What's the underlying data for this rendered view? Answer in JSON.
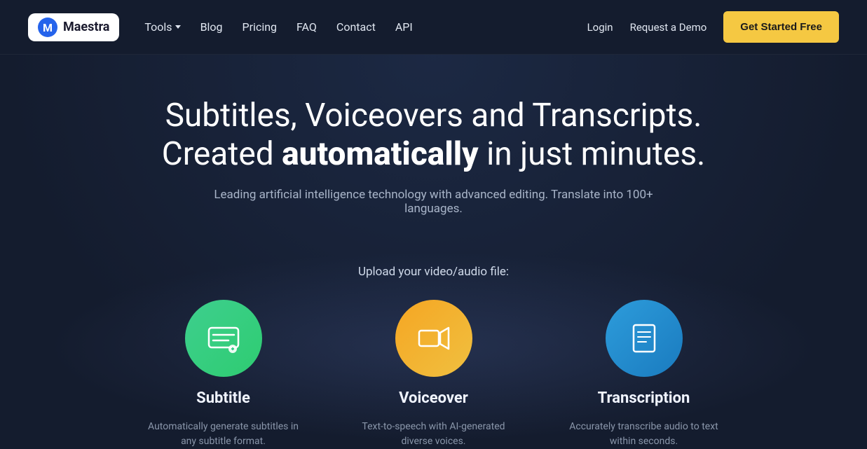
{
  "logo": {
    "text": "Maestra",
    "aria": "Maestra logo"
  },
  "nav": {
    "tools_label": "Tools",
    "blog_label": "Blog",
    "pricing_label": "Pricing",
    "faq_label": "FAQ",
    "contact_label": "Contact",
    "api_label": "API",
    "login_label": "Login",
    "request_demo_label": "Request a Demo",
    "get_started_label": "Get Started Free"
  },
  "hero": {
    "title_line1": "Subtitles, Voiceovers and Transcripts.",
    "title_line2_plain": "Created ",
    "title_line2_bold": "automatically",
    "title_line2_end": " in just minutes.",
    "subtitle": "Leading artificial intelligence technology with advanced editing. Translate into 100+ languages."
  },
  "upload": {
    "label": "Upload your video/audio file:",
    "cards": [
      {
        "id": "subtitle",
        "title": "Subtitle",
        "description": "Automatically generate subtitles in any subtitle format.",
        "icon_type": "subtitle"
      },
      {
        "id": "voiceover",
        "title": "Voiceover",
        "description": "Text-to-speech with AI-generated diverse voices.",
        "icon_type": "voiceover"
      },
      {
        "id": "transcription",
        "title": "Transcription",
        "description": "Accurately transcribe audio to text within seconds.",
        "icon_type": "transcription"
      }
    ]
  }
}
